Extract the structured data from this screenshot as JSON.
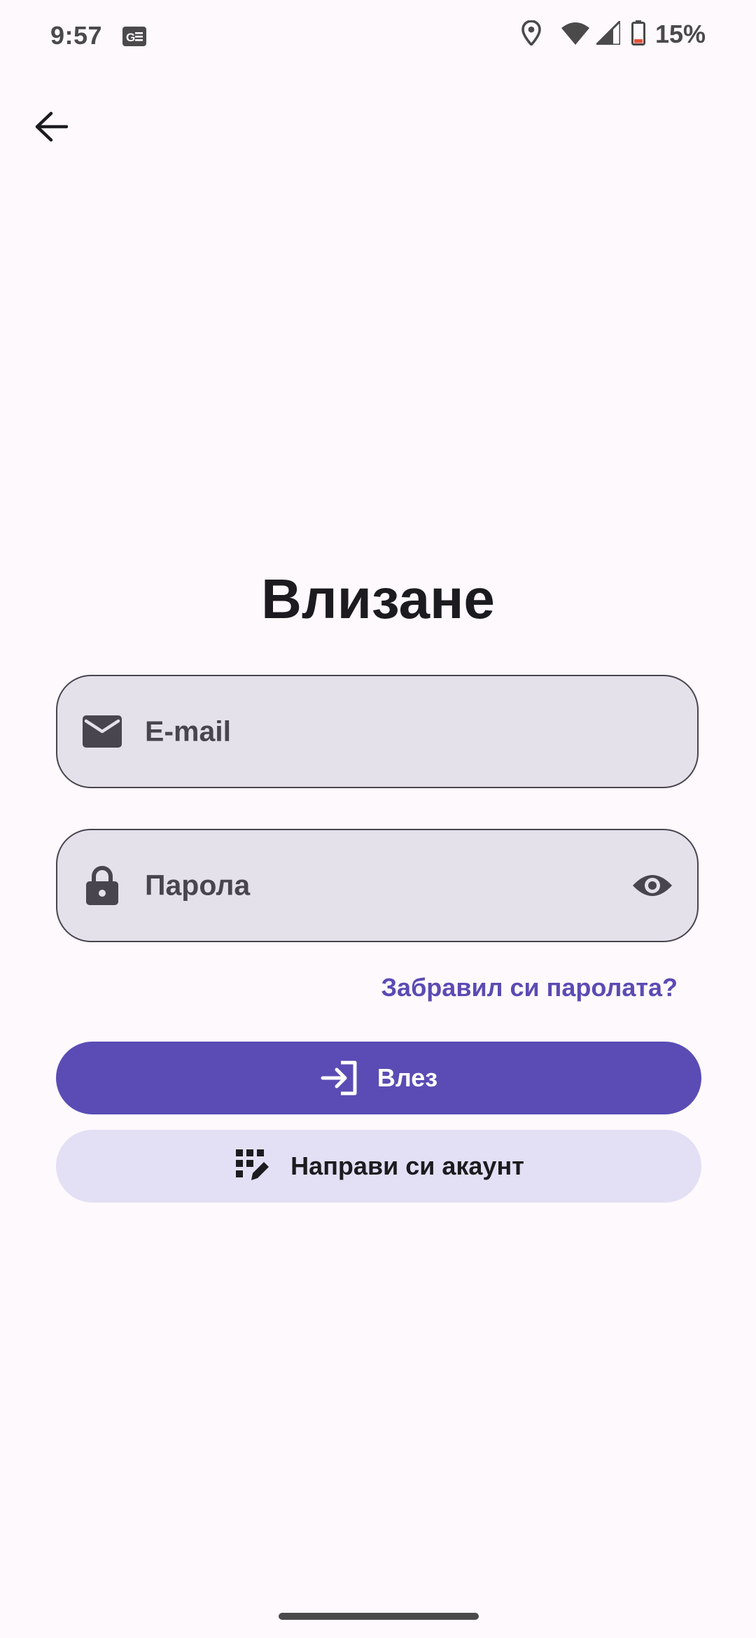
{
  "status_bar": {
    "time": "9:57",
    "battery_percent": "15%",
    "icons": [
      "news-icon",
      "location-icon",
      "wifi-icon",
      "cellular-signal-icon",
      "battery-low-icon"
    ]
  },
  "nav": {
    "back_icon": "arrow-back-icon"
  },
  "login": {
    "title": "Влизане",
    "email_field": {
      "label": "E-mail",
      "value": "",
      "icon": "mail-icon"
    },
    "password_field": {
      "label": "Парола",
      "value": "",
      "icon": "lock-icon",
      "toggle_icon": "eye-icon"
    },
    "forgot_password_label": "Забравил си паролата?",
    "login_button_label": "Влез",
    "login_button_icon": "login-icon",
    "register_button_label": "Направи си акаунт",
    "register_button_icon": "app-registration-icon"
  },
  "colors": {
    "background": "#FDF9FD",
    "primary": "#5A4CB4",
    "link": "#5B4BB3",
    "field_background": "#E5E1EA",
    "secondary_container": "#E3E0F5",
    "battery_low": "#E5533D"
  }
}
